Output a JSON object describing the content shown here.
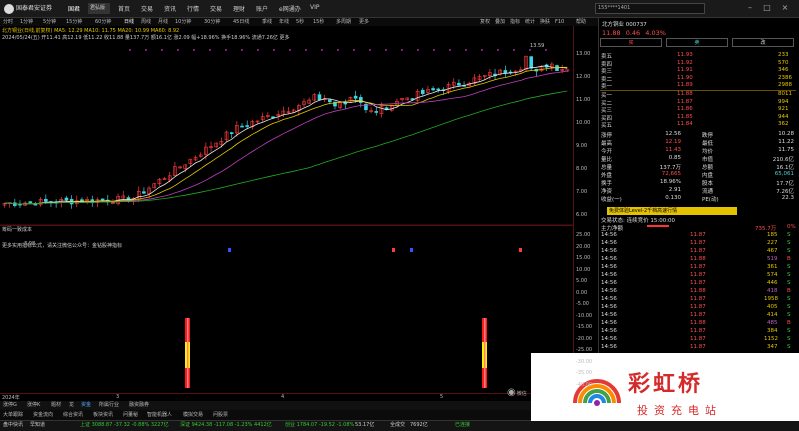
{
  "titlebar": {
    "logo": "国泰君安证券",
    "app_label": "国君",
    "account": "君弘版",
    "menus": [
      "首页",
      "交易",
      "资讯",
      "行情",
      "交易",
      "理财",
      "账户",
      "e网通办",
      "VIP"
    ],
    "search_text": "155****1401",
    "search_icon": "search-icon"
  },
  "period_bar": {
    "items": [
      "分时",
      "1分钟",
      "5分钟",
      "15分钟",
      "60分钟",
      "日线",
      "周线",
      "月线",
      "10分钟",
      "30分钟",
      "45日线",
      "季线",
      "年线",
      "5秒",
      "15秒",
      "多周期",
      "更多"
    ],
    "right_items": [
      "复权",
      "叠加",
      "指标",
      "统计",
      "换肤",
      "F10",
      "帮助"
    ]
  },
  "chart_info": {
    "line1": "北方铜业(日线,前复权)   MA5: 12.29  MA10: 11.75  MA20: 10.99  MA60: 8.92",
    "line2": "2024/05/24(五)   开11.41 高12.19 低11.22 收11.88 量137.7万 额16.1亿 涨2.09 幅+18.96% 换手18.96% 流通7.26亿  更多",
    "high_label": "13.59",
    "low_label": "3.98"
  },
  "price_axis": [
    "13.00",
    "12.00",
    "11.00",
    "10.00",
    "9.00",
    "8.00",
    "7.00",
    "6.00",
    "5.00",
    "4.00"
  ],
  "indicator": {
    "header": "筹码一致成本",
    "sub": "更多实用指标公式，请关注微信公众号：金钻股神指标",
    "axis": [
      "25.00",
      "20.00",
      "15.00",
      "10.00",
      "5.00",
      "0.00",
      "-5.00",
      "-10.00",
      "-15.00",
      "-20.00",
      "-25.00",
      "-30.00",
      "-35.00",
      "-40.00"
    ]
  },
  "date_axis": [
    "2024年",
    "3",
    "4",
    "5"
  ],
  "bottom_tabs": [
    "涨停G",
    "涨停K",
    "题材",
    "龙",
    "资金",
    "所属行业",
    "融资融券"
  ],
  "bottom_tabs2": [
    "大单跟踪",
    "资金流向",
    "综合资讯",
    "板块资讯",
    "问董秘",
    "智能机器人",
    "模拟交易",
    "问股票"
  ],
  "status_bar": {
    "items": [
      "盘中快讯",
      "早知道",
      "上证 3088.87 -37.32 -0.88% 3227亿",
      "深证 9424.38 -117.08 -1.23% 4412亿",
      "创业 1784.07 -19.52 -1.08%",
      "53.17亿",
      "全成交",
      "7692亿",
      "已连接"
    ]
  },
  "rpanel": {
    "stock": "北方铜业 000737",
    "price": "11.88",
    "change": "0.46",
    "pct": "4.03%",
    "buy_btn": "买",
    "sell_btn": "卖",
    "chg_btn": "改",
    "asks": [
      {
        "label": "卖五",
        "price": "11.93",
        "vol": "233"
      },
      {
        "label": "卖四",
        "price": "11.92",
        "vol": "570"
      },
      {
        "label": "卖三",
        "price": "11.91",
        "vol": "346"
      },
      {
        "label": "卖二",
        "price": "11.90",
        "vol": "2386"
      },
      {
        "label": "卖一",
        "price": "11.89",
        "vol": "2988"
      }
    ],
    "bids": [
      {
        "label": "买一",
        "price": "11.88",
        "vol": "8011"
      },
      {
        "label": "买二",
        "price": "11.87",
        "vol": "994"
      },
      {
        "label": "买三",
        "price": "11.86",
        "vol": "921"
      },
      {
        "label": "买四",
        "price": "11.85",
        "vol": "944"
      },
      {
        "label": "买五",
        "price": "11.84",
        "vol": "362"
      }
    ],
    "stats": [
      {
        "l": "涨停",
        "v": "12.56",
        "l2": "跌停",
        "v2": "10.28"
      },
      {
        "l": "最高",
        "v": "12.19",
        "l2": "最低",
        "v2": "11.22"
      },
      {
        "l": "今开",
        "v": "11.43",
        "l2": "均价",
        "v2": "11.75"
      },
      {
        "l": "量比",
        "v": "0.85",
        "l2": "市值",
        "v2": "210.6亿"
      },
      {
        "l": "总量",
        "v": "137.7万",
        "l2": "总额",
        "v2": "16.1亿"
      },
      {
        "l": "外盘",
        "v": "72,665",
        "l2": "内盘",
        "v2": "65,061"
      },
      {
        "l": "换手",
        "v": "18.96%",
        "l2": "股本",
        "v2": "17.7亿"
      },
      {
        "l": "净资",
        "v": "2.91",
        "l2": "流通",
        "v2": "7.26亿"
      },
      {
        "l": "收益(一)",
        "v": "0.130",
        "l2": "PE(动)",
        "v2": "22.3"
      }
    ],
    "promo": "免费体验Level-2千档高速行情",
    "trade_status": "交易状态: 连续竞价 15:00:00",
    "net_label": "主力净额",
    "net_value": "735.7万",
    "net_pct": "0%",
    "ticks": [
      {
        "t": "14:56",
        "p": "11.87",
        "v": "185",
        "d": "S"
      },
      {
        "t": "14:56",
        "p": "11.87",
        "v": "227",
        "d": "S"
      },
      {
        "t": "14:56",
        "p": "11.87",
        "v": "467",
        "d": "S"
      },
      {
        "t": "14:56",
        "p": "11.88",
        "v": "519",
        "d": "B"
      },
      {
        "t": "14:56",
        "p": "11.87",
        "v": "361",
        "d": "S"
      },
      {
        "t": "14:56",
        "p": "11.87",
        "v": "574",
        "d": "S"
      },
      {
        "t": "14:56",
        "p": "11.87",
        "v": "446",
        "d": "S"
      },
      {
        "t": "14:56",
        "p": "11.88",
        "v": "418",
        "d": "B"
      },
      {
        "t": "14:56",
        "p": "11.87",
        "v": "1958",
        "d": "S"
      },
      {
        "t": "14:56",
        "p": "11.87",
        "v": "405",
        "d": "S"
      },
      {
        "t": "14:56",
        "p": "11.87",
        "v": "414",
        "d": "S"
      },
      {
        "t": "14:56",
        "p": "11.88",
        "v": "485",
        "d": "B"
      },
      {
        "t": "14:56",
        "p": "11.87",
        "v": "384",
        "d": "S"
      },
      {
        "t": "14:56",
        "p": "11.87",
        "v": "1152",
        "d": "S"
      },
      {
        "t": "14:56",
        "p": "11.87",
        "v": "347",
        "d": "S"
      }
    ]
  },
  "watermark": {
    "title": "彩虹桥",
    "subtitle": "投资充电站",
    "wechat": "微信"
  }
}
